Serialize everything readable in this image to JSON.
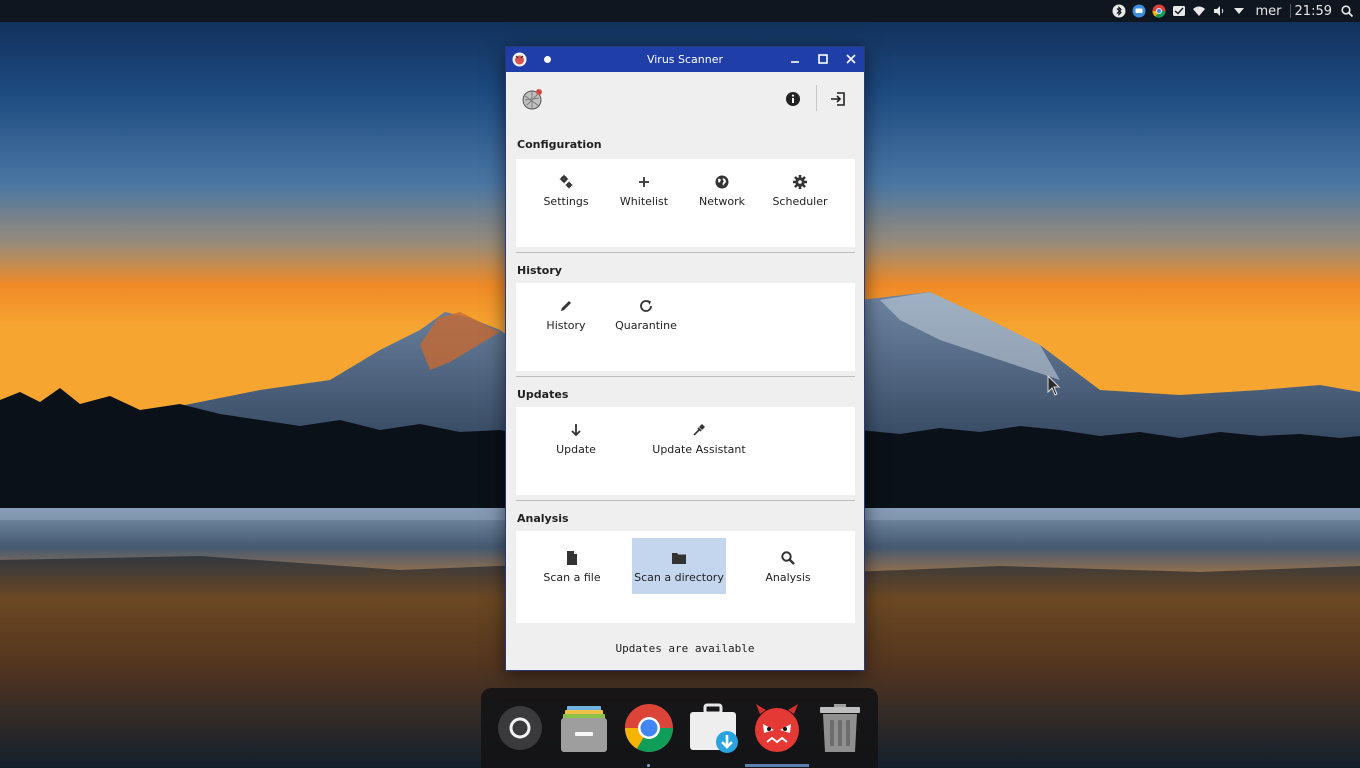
{
  "panel": {
    "day": "mer",
    "time": "21:59",
    "tray_icons": [
      "bluetooth-icon",
      "messaging-icon",
      "chrome-icon",
      "mail-icon",
      "wifi-icon",
      "volume-icon",
      "dropdown-icon"
    ],
    "search_icon": "search-icon"
  },
  "window": {
    "title": "Virus Scanner",
    "status": "Updates are available",
    "colors": {
      "titlebar": "#1f3ea8",
      "selected": "#c3d6ee",
      "panel": "#ffffff",
      "window_bg": "#efefef"
    }
  },
  "sections": {
    "configuration": {
      "title": "Configuration",
      "items": [
        {
          "label": "Settings",
          "icon": "cogs-icon"
        },
        {
          "label": "Whitelist",
          "icon": "plus-icon"
        },
        {
          "label": "Network",
          "icon": "globe-icon"
        },
        {
          "label": "Scheduler",
          "icon": "gear-icon"
        }
      ]
    },
    "history": {
      "title": "History",
      "items": [
        {
          "label": "History",
          "icon": "pencil-icon"
        },
        {
          "label": "Quarantine",
          "icon": "refresh-icon"
        }
      ]
    },
    "updates": {
      "title": "Updates",
      "items": [
        {
          "label": "Update",
          "icon": "download-arrow-icon"
        },
        {
          "label": "Update Assistant",
          "icon": "eyedropper-icon"
        }
      ]
    },
    "analysis": {
      "title": "Analysis",
      "selected": "Scan a directory",
      "items": [
        {
          "label": "Scan a file",
          "icon": "file-icon"
        },
        {
          "label": "Scan a directory",
          "icon": "folder-icon"
        },
        {
          "label": "Analysis",
          "icon": "search-icon"
        }
      ]
    }
  },
  "dock": {
    "items": [
      "launcher",
      "file-manager",
      "google-chrome",
      "software-installer",
      "virus-scanner",
      "trash"
    ]
  }
}
